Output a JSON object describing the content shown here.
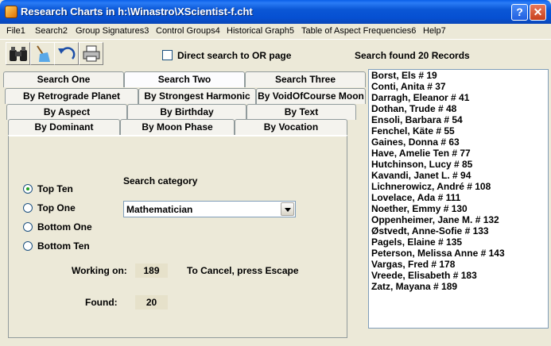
{
  "window": {
    "title": "Research Charts in h:\\Winastro\\XScientist-f.cht",
    "help_button": "?",
    "close_button": "✕"
  },
  "menu": [
    "File1",
    "Search2",
    "Group Signatures3",
    "Control Groups4",
    "Historical Graph5",
    "Table of Aspect Frequencies6",
    "Help7"
  ],
  "toolbar": {
    "direct_search_label": "Direct search to OR page",
    "status": "Search found 20 Records"
  },
  "tabs": {
    "row1": [
      "Search One",
      "Search Two",
      "Search Three"
    ],
    "row2": [
      "By Retrograde Planet",
      "By Strongest Harmonic",
      "By VoidOfCourse Moon"
    ],
    "row3": [
      "By Aspect",
      "By Birthday",
      "By Text"
    ],
    "row4": [
      "By Dominant",
      "By Moon Phase",
      "By Vocation"
    ]
  },
  "form": {
    "radio_options": [
      "Top Ten",
      "Top One",
      "Bottom One",
      "Bottom Ten"
    ],
    "selected_radio": "Top Ten",
    "category_label": "Search category",
    "category_value": "Mathematician",
    "working_label": "Working on:",
    "working_value": "189",
    "cancel_hint": "To Cancel, press Escape",
    "found_label": "Found:",
    "found_value": "20"
  },
  "results": [
    "Borst, Els  # 19",
    "Conti, Anita  # 37",
    "Darragh, Eleanor  # 41",
    "Dothan, Trude  # 48",
    "Ensoli, Barbara  # 54",
    "Fenchel, Käte  # 55",
    "Gaines, Donna  # 63",
    "Have, Amelie Ten  # 77",
    "Hutchinson, Lucy  # 85",
    "Kavandi, Janet L.  # 94",
    "Lichnerowicz, André  # 108",
    "Lovelace, Ada  # 111",
    "Noether, Emmy  # 130",
    "Oppenheimer, Jane M.  # 132",
    "Østvedt, Anne-Sofie  # 133",
    "Pagels, Elaine  # 135",
    "Peterson, Melissa Anne  # 143",
    "Vargas, Fred  # 178",
    "Vreede, Elisabeth  # 183",
    "Zatz, Mayana  # 189"
  ]
}
